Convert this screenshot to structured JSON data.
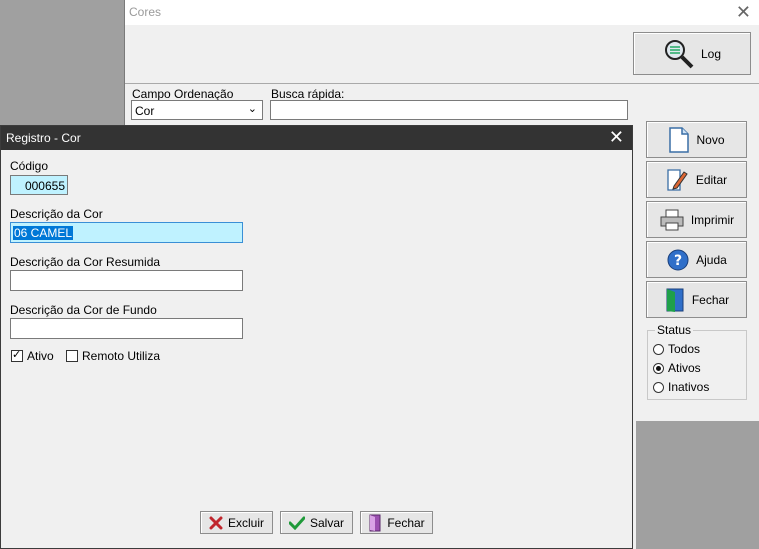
{
  "background_window": {
    "title": "Cores",
    "log_button": "Log",
    "campo_ordenacao_label": "Campo Ordenação",
    "campo_ordenacao_value": "Cor",
    "busca_rapida_label": "Busca rápida:",
    "busca_rapida_value": "",
    "side_buttons": [
      "Novo",
      "Editar",
      "Imprimir",
      "Ajuda",
      "Fechar"
    ],
    "status": {
      "legend": "Status",
      "options": [
        "Todos",
        "Ativos",
        "Inativos"
      ],
      "selected": "Ativos"
    }
  },
  "dialog": {
    "title": "Registro - Cor",
    "codigo_label": "Código",
    "codigo_value": "000655",
    "descricao_label": "Descrição da Cor",
    "descricao_value": "06 CAMEL",
    "descricao_resumida_label": "Descrição da Cor Resumida",
    "descricao_resumida_value": "",
    "descricao_fundo_label": "Descrição da Cor de Fundo",
    "descricao_fundo_value": "",
    "ativo_label": "Ativo",
    "ativo_checked": true,
    "remoto_label": "Remoto Utiliza",
    "remoto_checked": false,
    "buttons": {
      "excluir": "Excluir",
      "salvar": "Salvar",
      "fechar": "Fechar"
    }
  },
  "colors": {
    "dialog_titlebar": "#333333",
    "selected_field_bg": "#bff2ff",
    "selection": "#0078d7"
  },
  "icons": [
    "magnifier-list-icon",
    "new-document-icon",
    "edit-pencil-icon",
    "printer-icon",
    "help-icon",
    "exit-door-icon",
    "delete-x-icon",
    "checkmark-icon"
  ]
}
